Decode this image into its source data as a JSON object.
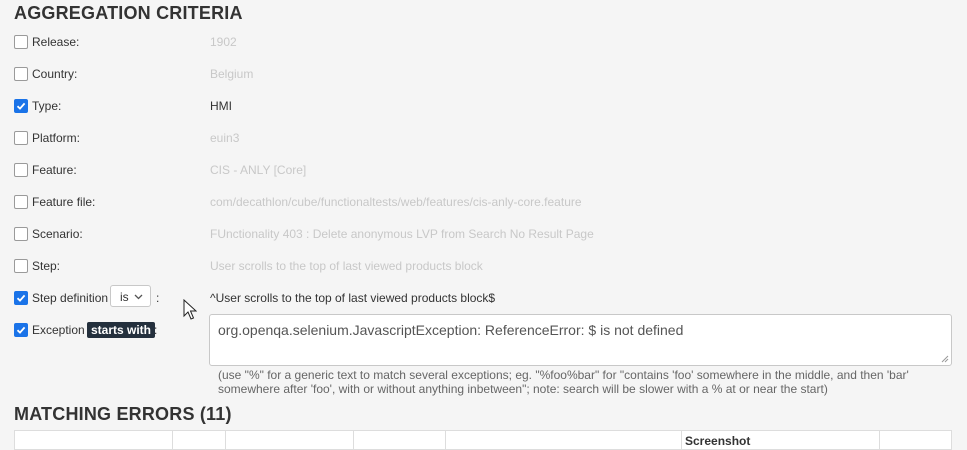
{
  "aggregation": {
    "title": "AGGREGATION CRITERIA",
    "rows": [
      {
        "label": "Release:",
        "value": "1902",
        "checked": false
      },
      {
        "label": "Country:",
        "value": "Belgium",
        "checked": false
      },
      {
        "label": "Type:",
        "value": "HMI",
        "checked": true
      },
      {
        "label": "Platform:",
        "value": "euin3",
        "checked": false
      },
      {
        "label": "Feature:",
        "value": "CIS - ANLY [Core]",
        "checked": false
      },
      {
        "label": "Feature file:",
        "value": "com/decathlon/cube/functionaltests/web/features/cis-anly-core.feature",
        "checked": false
      },
      {
        "label": "Scenario:",
        "value": "FUnctionality 403 : Delete anonymous LVP from Search No Result Page",
        "checked": false
      },
      {
        "label": "Step:",
        "value": "User scrolls to the top of last viewed products block",
        "checked": false
      }
    ],
    "step_definition": {
      "label": "Step definition",
      "operator": "is",
      "colon": ":",
      "value": "^User scrolls to the top of last viewed products block$",
      "checked": true
    },
    "exception": {
      "label": "Exception",
      "operator": "starts with",
      "colon": ":",
      "value": "org.openqa.selenium.JavascriptException: ReferenceError: $ is not defined",
      "checked": true,
      "hint": "(use \"%\" for a generic text to match several exceptions; eg. \"%foo%bar\" for \"contains 'foo' somewhere in the middle, and then 'bar' somewhere after 'foo', with or without anything inbetween\"; note: search will be slower with a % at or near the start)"
    }
  },
  "matching": {
    "title": "MATCHING ERRORS (11)",
    "table_header_partial": "Screenshot"
  },
  "colors": {
    "accent": "#1a73e8",
    "badge_bg": "#24303d",
    "disabled_text": "#c8c8c8"
  }
}
